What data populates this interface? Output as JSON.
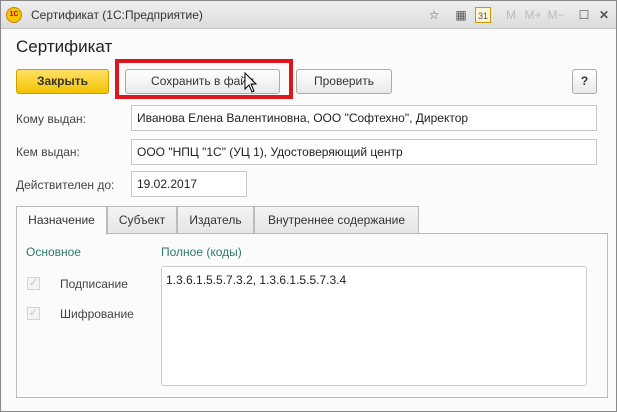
{
  "window": {
    "title": "Сертификат  (1С:Предприятие)",
    "toolbar_icons": [
      "favorites-icon",
      "calculator-icon",
      "calendar-icon",
      "memory-m",
      "memory-m-plus",
      "memory-m-minus",
      "maximize-icon",
      "close-icon"
    ],
    "mem": [
      "M",
      "M+",
      "M−"
    ],
    "calendar_day": "31"
  },
  "form": {
    "title": "Сертификат"
  },
  "buttons": {
    "close": "Закрыть",
    "save": "Сохранить в файл",
    "check": "Проверить",
    "help": "?"
  },
  "fields": {
    "issued_to": {
      "label": "Кому выдан:",
      "value": "Иванова Елена Валентиновна, ООО \"Софтехно\", Директор"
    },
    "issued_by": {
      "label": "Кем выдан:",
      "value": "ООО \"НПЦ \"1С\" (УЦ 1), Удостоверяющий центр"
    },
    "valid_until": {
      "label": "Действителен до:",
      "value": "19.02.2017"
    }
  },
  "tabs": [
    {
      "label": "Назначение",
      "active": true
    },
    {
      "label": "Субъект"
    },
    {
      "label": "Издатель"
    },
    {
      "label": "Внутреннее содержание"
    }
  ],
  "purpose": {
    "main_label": "Основное",
    "full_label": "Полное (коды)",
    "checks": [
      {
        "label": "Подписание",
        "checked": true
      },
      {
        "label": "Шифрование",
        "checked": true
      }
    ],
    "codes": "1.3.6.1.5.5.7.3.2, 1.3.6.1.5.5.7.3.4"
  },
  "colors": {
    "accent_yellow": "#f2c200",
    "highlight_red": "#e0161e",
    "group_green": "#2f7a6a"
  }
}
